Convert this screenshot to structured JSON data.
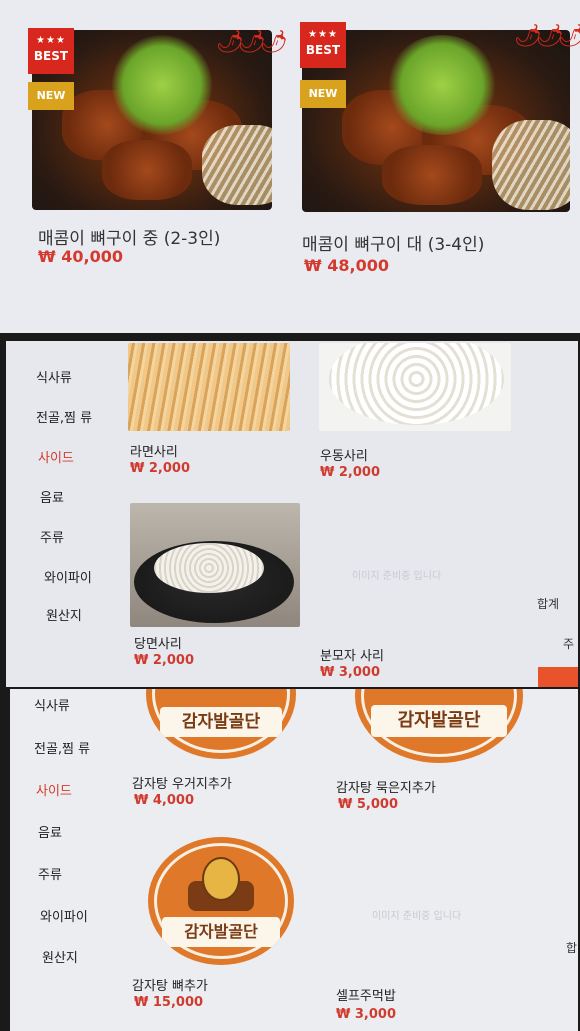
{
  "panel1": {
    "items": [
      {
        "name": "매콤이 뼈구이 중 (2-3인)",
        "price": "₩ 40,000",
        "badge_best_stars": "★★★",
        "badge_best": "BEST",
        "badge_new": "NEW",
        "spicy": "🌶🌶🌶"
      },
      {
        "name": "매콤이  뼈구이 대 (3-4인)",
        "price": "₩ 48,000",
        "badge_best_stars": "★★★",
        "badge_best": "BEST",
        "badge_new": "NEW",
        "spicy": "🌶🌶🌶"
      }
    ]
  },
  "sidebar": {
    "items": [
      {
        "label": "식사류"
      },
      {
        "label": "전골,찜 류"
      },
      {
        "label": "사이드"
      },
      {
        "label": "음료"
      },
      {
        "label": "주류"
      },
      {
        "label": "와이파이"
      },
      {
        "label": "원산지"
      }
    ],
    "active_index": 2
  },
  "panel2": {
    "products": [
      {
        "name": "라면사리",
        "price": "₩ 2,000"
      },
      {
        "name": "우동사리",
        "price": "₩ 2,000"
      },
      {
        "name": "당면사리",
        "price": "₩ 2,000"
      },
      {
        "name": "분모자 사리",
        "price": "₩ 3,000"
      }
    ],
    "placeholder": "이미지 준비중 입니다",
    "edge_labels": [
      "합계",
      "주"
    ]
  },
  "panel3": {
    "products": [
      {
        "name": "감자탕 우거지추가",
        "price": "₩ 4,000"
      },
      {
        "name": "감자탕 묵은지추가",
        "price": "₩ 5,000"
      },
      {
        "name": "감자탕 뼈추가",
        "price": "₩ 15,000"
      },
      {
        "name": "셀프주먹밥",
        "price": "₩ 3,000"
      }
    ],
    "logo_text": "감자발골단",
    "placeholder": "이미지 준비중 입니다",
    "edge_label": "합"
  },
  "colors": {
    "accent_red": "#d63a2b",
    "badge_best": "#d8281e",
    "badge_new": "#d9a21c",
    "logo_orange": "#e0782a"
  }
}
